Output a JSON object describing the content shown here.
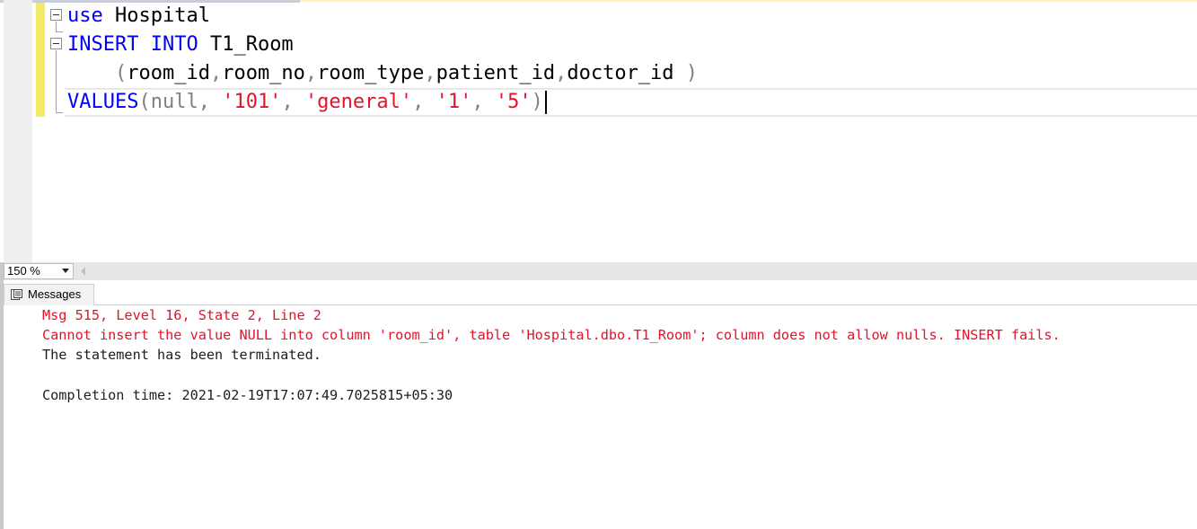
{
  "editor": {
    "lines": [
      [
        {
          "t": "use",
          "c": "kw"
        },
        {
          "t": " Hospital",
          "c": ""
        }
      ],
      [
        {
          "t": "INSERT",
          "c": "kw"
        },
        {
          "t": " ",
          "c": ""
        },
        {
          "t": "INTO",
          "c": "kw"
        },
        {
          "t": " T1_Room",
          "c": ""
        }
      ],
      [
        {
          "t": "    ",
          "c": ""
        },
        {
          "t": "(",
          "c": "gr"
        },
        {
          "t": "room_id",
          "c": ""
        },
        {
          "t": ",",
          "c": "gr"
        },
        {
          "t": "room_no",
          "c": ""
        },
        {
          "t": ",",
          "c": "gr"
        },
        {
          "t": "room_type",
          "c": ""
        },
        {
          "t": ",",
          "c": "gr"
        },
        {
          "t": "patient_id",
          "c": ""
        },
        {
          "t": ",",
          "c": "gr"
        },
        {
          "t": "doctor_id ",
          "c": ""
        },
        {
          "t": ")",
          "c": "gr"
        }
      ],
      [
        {
          "t": "VALUES",
          "c": "kw"
        },
        {
          "t": "(null, ",
          "c": "gr"
        },
        {
          "t": "'101'",
          "c": "st"
        },
        {
          "t": ", ",
          "c": "gr"
        },
        {
          "t": "'general'",
          "c": "st"
        },
        {
          "t": ", ",
          "c": "gr"
        },
        {
          "t": "'1'",
          "c": "st"
        },
        {
          "t": ", ",
          "c": "gr"
        },
        {
          "t": "'5'",
          "c": "st"
        },
        {
          "t": ")",
          "c": "gr"
        }
      ]
    ]
  },
  "zoom": {
    "value": "150 %"
  },
  "results": {
    "tab_label": "Messages",
    "messages": [
      {
        "text": "Msg 515, Level 16, State 2, Line 2",
        "kind": "red"
      },
      {
        "text": "Cannot insert the value NULL into column 'room_id', table 'Hospital.dbo.T1_Room'; column does not allow nulls. INSERT fails.",
        "kind": "red"
      },
      {
        "text": "The statement has been terminated.",
        "kind": "black"
      },
      {
        "text": "",
        "kind": "black"
      },
      {
        "text": "Completion time: 2021-02-19T17:07:49.7025815+05:30",
        "kind": "black"
      }
    ]
  },
  "colors": {
    "keyword": "#0000ff",
    "operator": "#808080",
    "string": "#e0142a",
    "error": "#e0142a",
    "change_marker": "#f5e96a"
  },
  "icons": {
    "collapse": "minus-box-icon",
    "zoom_dropdown": "chevron-down-icon",
    "scroll_left": "triangle-left-icon",
    "messages_tab": "messages-icon"
  }
}
